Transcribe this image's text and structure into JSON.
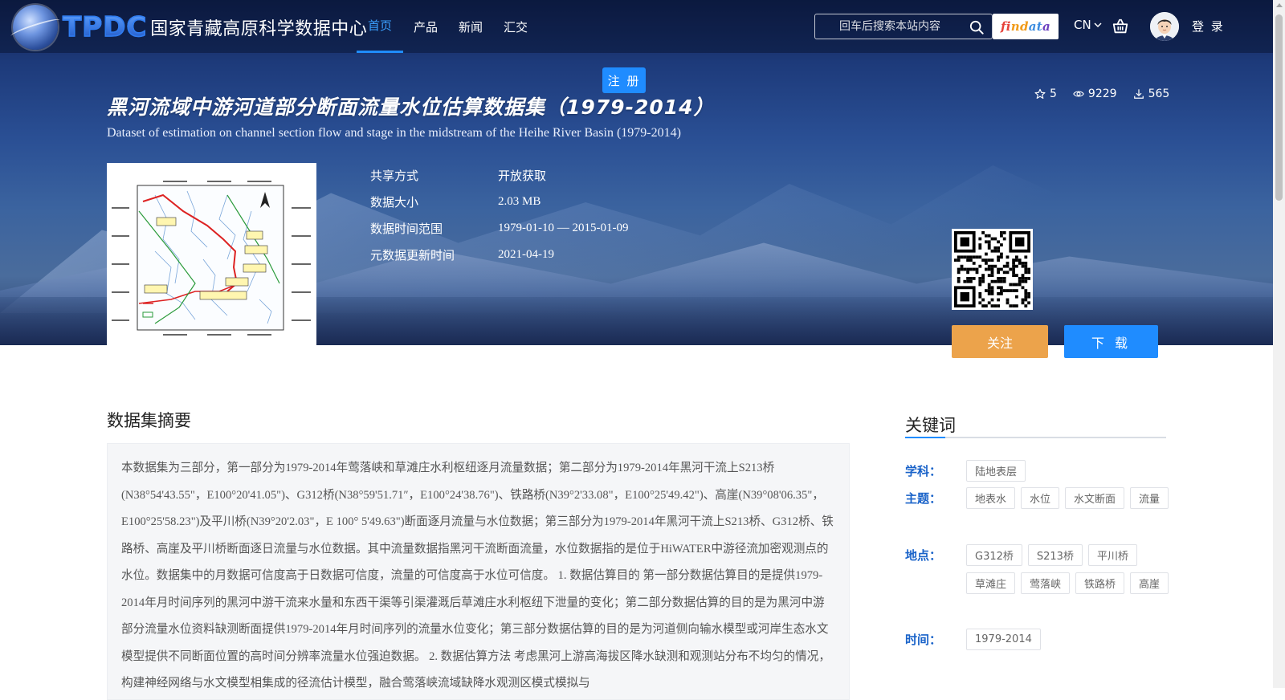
{
  "header": {
    "logo_abbr": "TPDC",
    "logo_title": "国家青藏高原科学数据中心",
    "nav": [
      {
        "label": "首页",
        "active": true
      },
      {
        "label": "产品",
        "active": false
      },
      {
        "label": "新闻",
        "active": false
      },
      {
        "label": "汇交",
        "active": false
      }
    ],
    "search_placeholder": "回车后搜索本站内容",
    "findata_parts": [
      "fi",
      "nd",
      "at",
      "a"
    ],
    "language": "CN",
    "login_label": "登 录",
    "register_label": "注 册"
  },
  "dataset": {
    "title_cn": "黑河流域中游河道部分断面流量水位估算数据集（1979-2014）",
    "title_en": "Dataset of estimation on channel section flow and stage in the midstream of the Heihe River Basin (1979-2014)",
    "stats": {
      "stars": "5",
      "views": "9229",
      "downloads": "565"
    },
    "meta": [
      {
        "label": "共享方式",
        "value": "开放获取"
      },
      {
        "label": "数据大小",
        "value": "2.03 MB"
      },
      {
        "label": "数据时间范围",
        "value": "1979-01-10 — 2015-01-09"
      },
      {
        "label": "元数据更新时间",
        "value": "2021-04-19"
      }
    ],
    "follow_label": "关注",
    "download_label": "下 载"
  },
  "abstract": {
    "heading": "数据集摘要",
    "text": "本数据集为三部分，第一部分为1979-2014年莺落峡和草滩庄水利枢纽逐月流量数据；第二部分为1979-2014年黑河干流上S213桥(N38°54'43.55\"，E100°20'41.05\")、G312桥(N38°59'51.71″，E100°24'38.76\")、铁路桥(N39°2'33.08\"，E100°25'49.42\")、高崖(N39°08'06.35\"，E100°25'58.23\")及平川桥(N39°20'2.03\"，E 100° 5'49.63\")断面逐月流量与水位数据；第三部分为1979-2014年黑河干流上S213桥、G312桥、铁路桥、高崖及平川桥断面逐日流量与水位数据。其中流量数据指黑河干流断面流量，水位数据指的是位于HiWATER中游径流加密观测点的水位。数据集中的月数据可信度高于日数据可信度，流量的可信度高于水位可信度。 1. 数据估算目的 第一部分数据估算目的是提供1979-2014年月时间序列的黑河中游干流来水量和东西干渠等引渠灌溉后草滩庄水利枢纽下泄量的变化；第二部分数据估算的目的是为黑河中游部分流量水位资料缺测断面提供1979-2014年月时间序列的流量水位变化；第三部分数据估算的目的是为河道侧向输水模型或河岸生态水文模型提供不同断面位置的高时间分辨率流量水位强迫数据。 2. 数据估算方法 考虑黑河上游高海拔区降水缺测和观测站分布不均匀的情况，构建神经网络与水文模型相集成的径流估计模型，融合莺落峡流域缺降水观测区模式模拟与"
  },
  "keywords": {
    "heading": "关键词",
    "groups": [
      {
        "label": "学科：",
        "tags": [
          "陆地表层"
        ]
      },
      {
        "label": "主题：",
        "tags": [
          "地表水",
          "水位",
          "水文断面",
          "流量"
        ]
      },
      {
        "label": "地点：",
        "tags": [
          "G312桥",
          "S213桥",
          "平川桥",
          "草滩庄",
          "莺落峡",
          "铁路桥",
          "高崖"
        ]
      },
      {
        "label": "时间：",
        "tags": [
          "1979-2014"
        ]
      }
    ]
  },
  "colors": {
    "accent": "#1f8cff",
    "follow": "#eca34b",
    "keyword_label": "#1a63c9"
  }
}
